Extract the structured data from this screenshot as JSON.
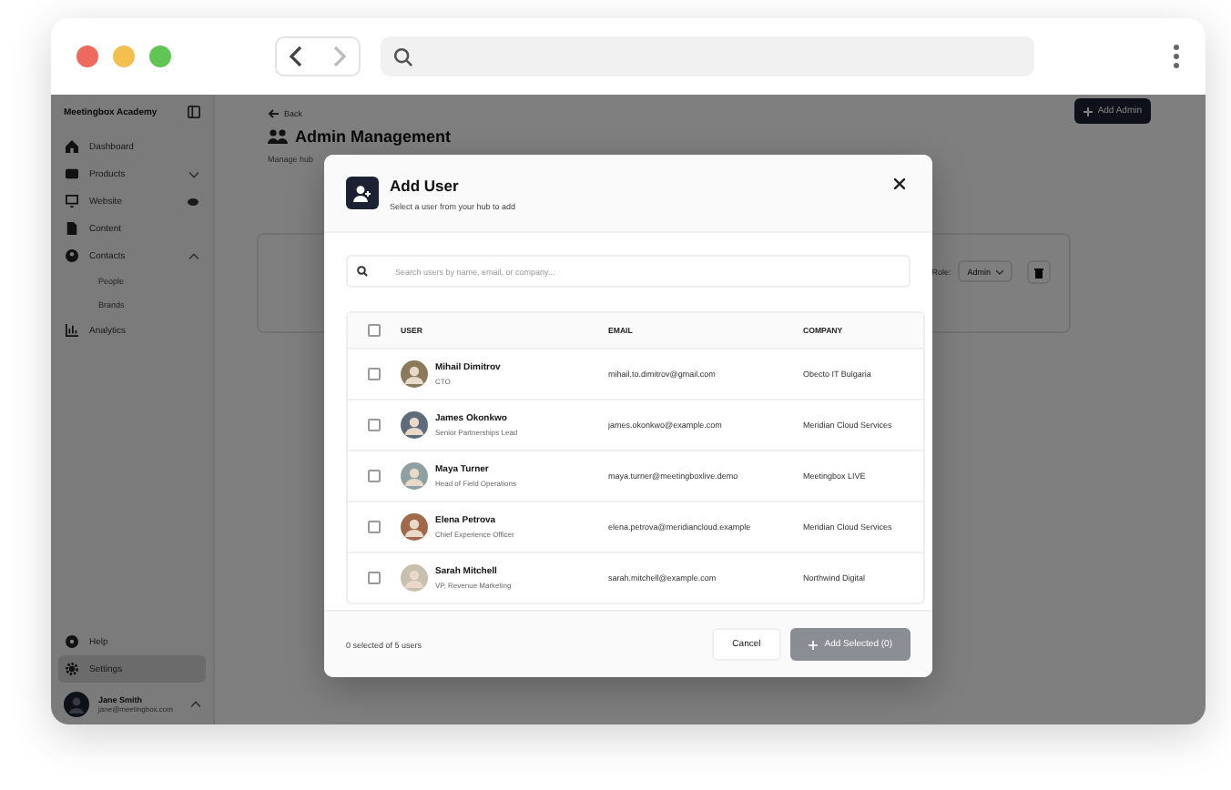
{
  "sidebar": {
    "workspace": "Meetingbox Academy",
    "items": [
      {
        "label": "Dashboard",
        "selected": false
      },
      {
        "label": "Products",
        "selected": false,
        "expanded": false
      },
      {
        "label": "Website",
        "selected": false,
        "visible": true
      },
      {
        "label": "Content",
        "selected": false
      },
      {
        "label": "Contacts",
        "selected": false,
        "expanded": true,
        "children": [
          {
            "label": "People",
            "selected": false
          },
          {
            "label": "Brands",
            "selected": false
          }
        ]
      },
      {
        "label": "Analytics",
        "selected": false
      }
    ],
    "bottom_items": [
      {
        "label": "Help",
        "selected": false
      },
      {
        "label": "Settings",
        "selected": true
      }
    ],
    "user": {
      "name": "Jane Smith",
      "email": "jane@meetingbox.com"
    }
  },
  "page": {
    "back": "Back",
    "title": "Admin Management",
    "subtitle": "Manage hub",
    "add_button": "Add Admin",
    "role_label": "Role:",
    "role_value": "Admin"
  },
  "modal": {
    "title": "Add User",
    "subtitle": "Select a user from your hub to add",
    "search": {
      "placeholder": "Search users by name, email, or company..."
    },
    "columns": [
      "USER",
      "EMAIL",
      "COMPANY"
    ],
    "select_all": {
      "checked": false
    },
    "rows": [
      {
        "name": "Mihail Dimitrov",
        "role": "CTO",
        "email": "mihail.to.dimitrov@gmail.com",
        "company": "Obecto IT Bulgaria",
        "checked": false
      },
      {
        "name": "James Okonkwo",
        "role": "Senior Partnerships Lead",
        "email": "james.okonkwo@example.com",
        "company": "Meridian Cloud Services",
        "checked": false
      },
      {
        "name": "Maya Turner",
        "role": "Head of Field Operations",
        "email": "maya.turner@meetingboxlive.demo",
        "company": "Meetingbox LIVE",
        "checked": false
      },
      {
        "name": "Elena Petrova",
        "role": "Chief Experience Officer",
        "email": "elena.petrova@meridiancloud.example",
        "company": "Meridian Cloud Services",
        "checked": false
      },
      {
        "name": "Sarah Mitchell",
        "role": "VP, Revenue Marketing",
        "email": "sarah.mitchell@example.com",
        "company": "Northwind Digital",
        "checked": false
      }
    ],
    "count": "0 selected of 5 users",
    "cancel": "Cancel",
    "add": {
      "label": "Add Selected (0)",
      "disabled": true
    }
  }
}
